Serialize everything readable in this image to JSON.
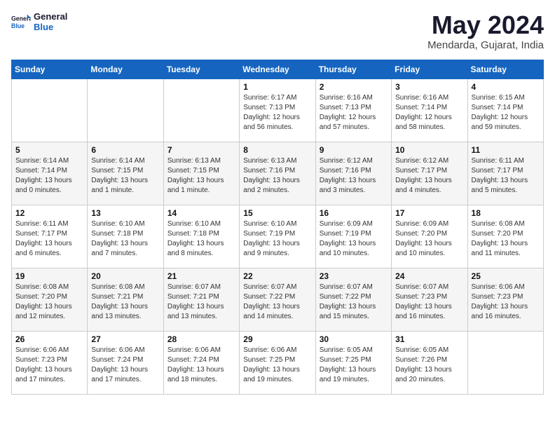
{
  "header": {
    "logo_line1": "General",
    "logo_line2": "Blue",
    "month": "May 2024",
    "location": "Mendarda, Gujarat, India"
  },
  "weekdays": [
    "Sunday",
    "Monday",
    "Tuesday",
    "Wednesday",
    "Thursday",
    "Friday",
    "Saturday"
  ],
  "weeks": [
    [
      {
        "day": "",
        "info": ""
      },
      {
        "day": "",
        "info": ""
      },
      {
        "day": "",
        "info": ""
      },
      {
        "day": "1",
        "info": "Sunrise: 6:17 AM\nSunset: 7:13 PM\nDaylight: 12 hours\nand 56 minutes."
      },
      {
        "day": "2",
        "info": "Sunrise: 6:16 AM\nSunset: 7:13 PM\nDaylight: 12 hours\nand 57 minutes."
      },
      {
        "day": "3",
        "info": "Sunrise: 6:16 AM\nSunset: 7:14 PM\nDaylight: 12 hours\nand 58 minutes."
      },
      {
        "day": "4",
        "info": "Sunrise: 6:15 AM\nSunset: 7:14 PM\nDaylight: 12 hours\nand 59 minutes."
      }
    ],
    [
      {
        "day": "5",
        "info": "Sunrise: 6:14 AM\nSunset: 7:14 PM\nDaylight: 13 hours\nand 0 minutes."
      },
      {
        "day": "6",
        "info": "Sunrise: 6:14 AM\nSunset: 7:15 PM\nDaylight: 13 hours\nand 1 minute."
      },
      {
        "day": "7",
        "info": "Sunrise: 6:13 AM\nSunset: 7:15 PM\nDaylight: 13 hours\nand 1 minute."
      },
      {
        "day": "8",
        "info": "Sunrise: 6:13 AM\nSunset: 7:16 PM\nDaylight: 13 hours\nand 2 minutes."
      },
      {
        "day": "9",
        "info": "Sunrise: 6:12 AM\nSunset: 7:16 PM\nDaylight: 13 hours\nand 3 minutes."
      },
      {
        "day": "10",
        "info": "Sunrise: 6:12 AM\nSunset: 7:17 PM\nDaylight: 13 hours\nand 4 minutes."
      },
      {
        "day": "11",
        "info": "Sunrise: 6:11 AM\nSunset: 7:17 PM\nDaylight: 13 hours\nand 5 minutes."
      }
    ],
    [
      {
        "day": "12",
        "info": "Sunrise: 6:11 AM\nSunset: 7:17 PM\nDaylight: 13 hours\nand 6 minutes."
      },
      {
        "day": "13",
        "info": "Sunrise: 6:10 AM\nSunset: 7:18 PM\nDaylight: 13 hours\nand 7 minutes."
      },
      {
        "day": "14",
        "info": "Sunrise: 6:10 AM\nSunset: 7:18 PM\nDaylight: 13 hours\nand 8 minutes."
      },
      {
        "day": "15",
        "info": "Sunrise: 6:10 AM\nSunset: 7:19 PM\nDaylight: 13 hours\nand 9 minutes."
      },
      {
        "day": "16",
        "info": "Sunrise: 6:09 AM\nSunset: 7:19 PM\nDaylight: 13 hours\nand 10 minutes."
      },
      {
        "day": "17",
        "info": "Sunrise: 6:09 AM\nSunset: 7:20 PM\nDaylight: 13 hours\nand 10 minutes."
      },
      {
        "day": "18",
        "info": "Sunrise: 6:08 AM\nSunset: 7:20 PM\nDaylight: 13 hours\nand 11 minutes."
      }
    ],
    [
      {
        "day": "19",
        "info": "Sunrise: 6:08 AM\nSunset: 7:20 PM\nDaylight: 13 hours\nand 12 minutes."
      },
      {
        "day": "20",
        "info": "Sunrise: 6:08 AM\nSunset: 7:21 PM\nDaylight: 13 hours\nand 13 minutes."
      },
      {
        "day": "21",
        "info": "Sunrise: 6:07 AM\nSunset: 7:21 PM\nDaylight: 13 hours\nand 13 minutes."
      },
      {
        "day": "22",
        "info": "Sunrise: 6:07 AM\nSunset: 7:22 PM\nDaylight: 13 hours\nand 14 minutes."
      },
      {
        "day": "23",
        "info": "Sunrise: 6:07 AM\nSunset: 7:22 PM\nDaylight: 13 hours\nand 15 minutes."
      },
      {
        "day": "24",
        "info": "Sunrise: 6:07 AM\nSunset: 7:23 PM\nDaylight: 13 hours\nand 16 minutes."
      },
      {
        "day": "25",
        "info": "Sunrise: 6:06 AM\nSunset: 7:23 PM\nDaylight: 13 hours\nand 16 minutes."
      }
    ],
    [
      {
        "day": "26",
        "info": "Sunrise: 6:06 AM\nSunset: 7:23 PM\nDaylight: 13 hours\nand 17 minutes."
      },
      {
        "day": "27",
        "info": "Sunrise: 6:06 AM\nSunset: 7:24 PM\nDaylight: 13 hours\nand 17 minutes."
      },
      {
        "day": "28",
        "info": "Sunrise: 6:06 AM\nSunset: 7:24 PM\nDaylight: 13 hours\nand 18 minutes."
      },
      {
        "day": "29",
        "info": "Sunrise: 6:06 AM\nSunset: 7:25 PM\nDaylight: 13 hours\nand 19 minutes."
      },
      {
        "day": "30",
        "info": "Sunrise: 6:05 AM\nSunset: 7:25 PM\nDaylight: 13 hours\nand 19 minutes."
      },
      {
        "day": "31",
        "info": "Sunrise: 6:05 AM\nSunset: 7:26 PM\nDaylight: 13 hours\nand 20 minutes."
      },
      {
        "day": "",
        "info": ""
      }
    ]
  ]
}
